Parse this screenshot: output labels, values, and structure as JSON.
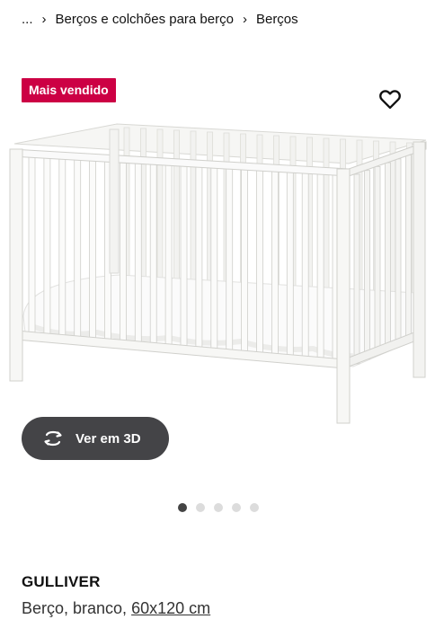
{
  "breadcrumb": {
    "ellipsis": "...",
    "separator": "›",
    "items": [
      "Berços e colchões para berço",
      "Berços"
    ]
  },
  "badge": {
    "label": "Mais vendido",
    "color": "#cc0044"
  },
  "favorite": {
    "icon": "heart-outline-icon"
  },
  "view3d": {
    "label": "Ver em 3D",
    "icon": "rotate-3d-icon",
    "background": "#444447"
  },
  "carousel": {
    "count": 5,
    "active_index": 1
  },
  "product": {
    "name": "GULLIVER",
    "description": "Berço, branco,",
    "size": "60x120 cm"
  }
}
